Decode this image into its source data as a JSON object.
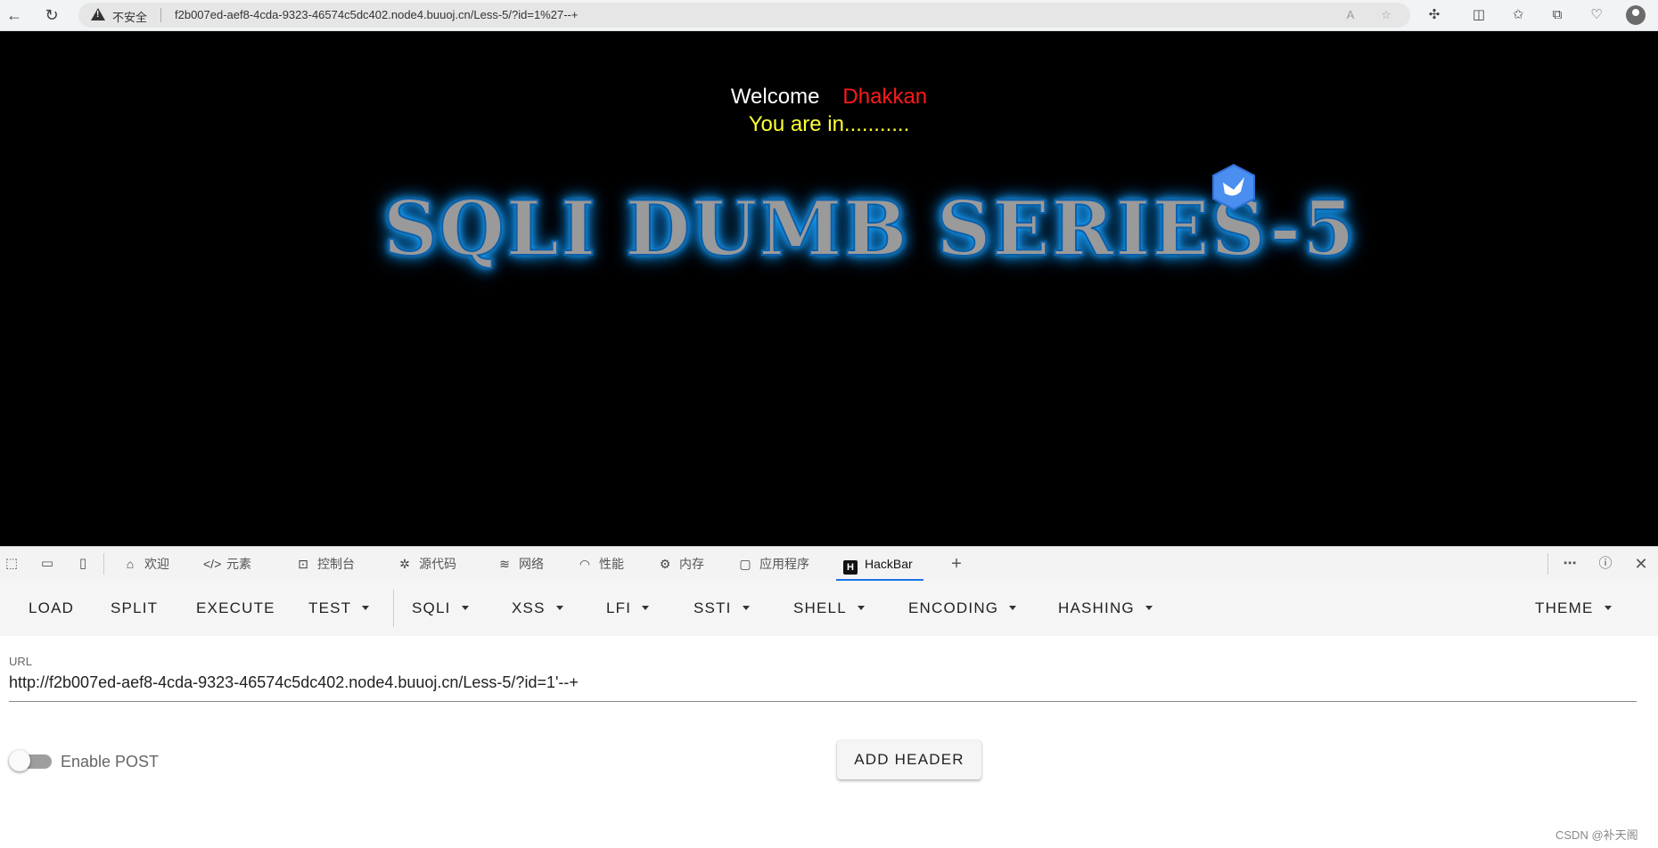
{
  "browser": {
    "insecure_label": "不安全",
    "address": "f2b007ed-aef8-4cda-9323-46574c5dc402.node4.buuoj.cn/Less-5/?id=1%27--+"
  },
  "page": {
    "welcome": "Welcome",
    "user": "Dhakkan",
    "status": "You are in...........",
    "banner": "SQLI DUMB SERIES-5",
    "colors": {
      "background": "#000000",
      "welcome": "#ffffff",
      "user": "#ff1a1a",
      "status": "#ffff33",
      "glow": "#19a4ff"
    }
  },
  "devtools": {
    "tabs": [
      {
        "label": "欢迎",
        "icon": "home-icon"
      },
      {
        "label": "元素",
        "icon": "code-icon"
      },
      {
        "label": "控制台",
        "icon": "console-icon"
      },
      {
        "label": "源代码",
        "icon": "bug-icon"
      },
      {
        "label": "网络",
        "icon": "wifi-icon"
      },
      {
        "label": "性能",
        "icon": "gauge-icon"
      },
      {
        "label": "内存",
        "icon": "chip-icon"
      },
      {
        "label": "应用程序",
        "icon": "window-icon"
      },
      {
        "label": "HackBar",
        "icon": "hackbar-icon",
        "active": true
      }
    ],
    "hackbar_logo": "H"
  },
  "hackbar": {
    "menu": {
      "load": "LOAD",
      "split": "SPLIT",
      "execute": "EXECUTE",
      "test": "TEST",
      "sqli": "SQLI",
      "xss": "XSS",
      "lfi": "LFI",
      "ssti": "SSTI",
      "shell": "SHELL",
      "encoding": "ENCODING",
      "hashing": "HASHING",
      "theme": "THEME"
    },
    "url_label": "URL",
    "url_value": "http://f2b007ed-aef8-4cda-9323-46574c5dc402.node4.buuoj.cn/Less-5/?id=1'--+",
    "enable_post_label": "Enable POST",
    "enable_post": false,
    "add_header_label": "ADD HEADER"
  },
  "watermark": "CSDN @补天阁"
}
